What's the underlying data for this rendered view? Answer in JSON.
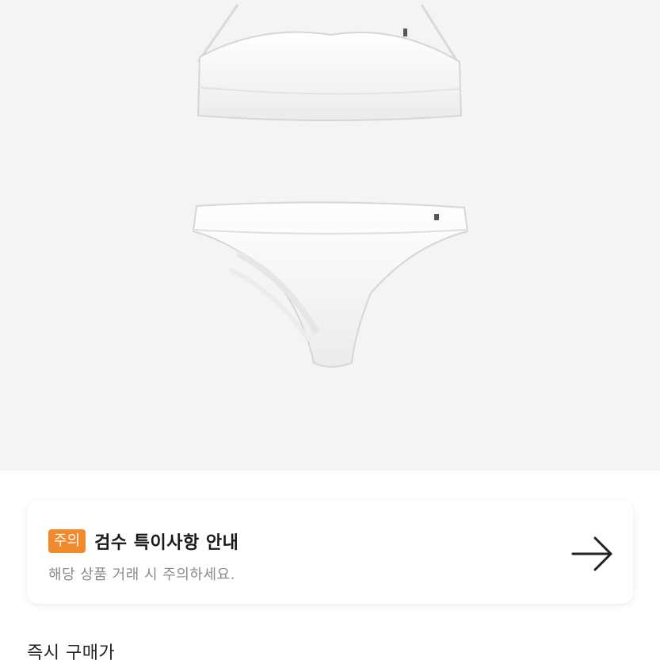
{
  "notice": {
    "badge": "주의",
    "title": "검수 특이사항 안내",
    "subtitle": "해당 상품 거래 시 주의하세요.",
    "arrow_icon": "arrow-right-icon",
    "badge_color": "#f08a2c"
  },
  "section": {
    "title": "즉시 구매가"
  },
  "colors": {
    "product_bg": "#f4f4f4"
  }
}
